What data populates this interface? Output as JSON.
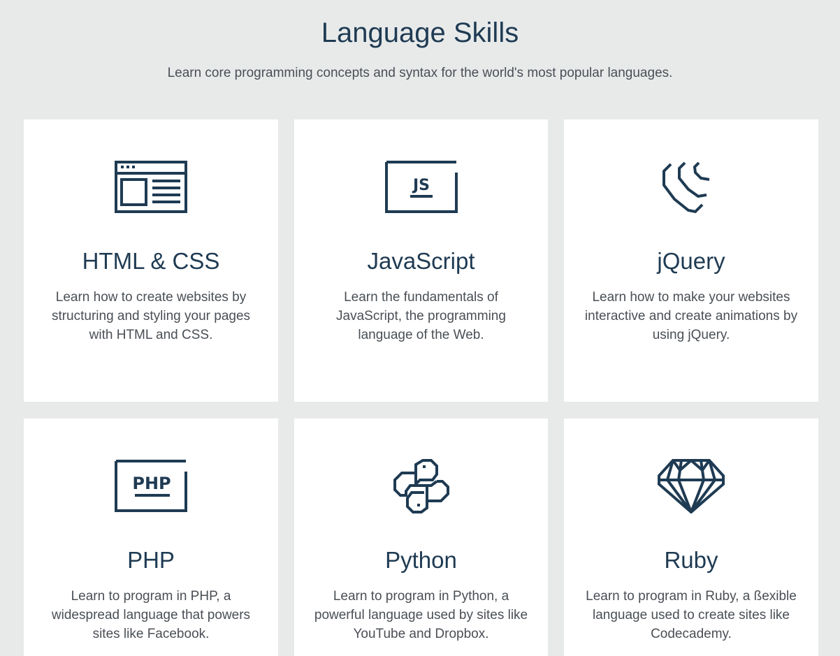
{
  "header": {
    "title": "Language Skills",
    "subtitle": "Learn core programming concepts and syntax for the world's most popular languages."
  },
  "colors": {
    "background": "#e8eaea",
    "card": "#ffffff",
    "accent": "#1f3b53",
    "text": "#4a4f55"
  },
  "cards": [
    {
      "icon": "browser-window-icon",
      "title": "HTML & CSS",
      "description": "Learn how to create websites by structuring and styling your pages with HTML and CSS."
    },
    {
      "icon": "js-file-icon",
      "icon_text": "JS",
      "title": "JavaScript",
      "description": "Learn the fundamentals of JavaScript, the programming language of the Web."
    },
    {
      "icon": "jquery-logo-icon",
      "title": "jQuery",
      "description": "Learn how to make your websites interactive and create animations by using jQuery."
    },
    {
      "icon": "php-file-icon",
      "icon_text": "PHP",
      "title": "PHP",
      "description": "Learn to program in PHP, a widespread language that powers sites like Facebook."
    },
    {
      "icon": "python-logo-icon",
      "title": "Python",
      "description": "Learn to program in Python, a powerful language used by sites like YouTube and Dropbox."
    },
    {
      "icon": "ruby-gem-icon",
      "title": "Ruby",
      "description": "Learn to program in Ruby, a ßexible language used to create sites like Codecademy."
    }
  ]
}
